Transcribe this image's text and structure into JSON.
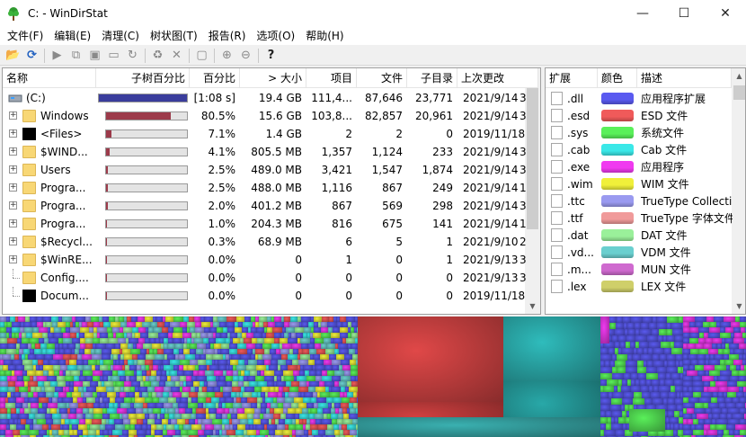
{
  "window": {
    "title": "C: - WinDirStat",
    "minimize": "—",
    "maximize": "☐",
    "close": "✕"
  },
  "menu": [
    "文件(F)",
    "编辑(E)",
    "清理(C)",
    "树状图(T)",
    "报告(R)",
    "选项(O)",
    "帮助(H)"
  ],
  "toolbar": [
    {
      "name": "open-icon",
      "glyph": "📂",
      "on": true
    },
    {
      "name": "refresh-icon",
      "glyph": "⟳",
      "on": true
    },
    {
      "name": "sep"
    },
    {
      "name": "play-icon",
      "glyph": "▶",
      "on": false
    },
    {
      "name": "copy-icon",
      "glyph": "⧉",
      "on": false
    },
    {
      "name": "explorer-icon",
      "glyph": "▣",
      "on": false
    },
    {
      "name": "cmd-icon",
      "glyph": "▭",
      "on": false
    },
    {
      "name": "refresh-selected-icon",
      "glyph": "↻",
      "on": false
    },
    {
      "name": "sep"
    },
    {
      "name": "recycle-icon",
      "glyph": "♻",
      "on": false
    },
    {
      "name": "delete-icon",
      "glyph": "✕",
      "on": false
    },
    {
      "name": "sep"
    },
    {
      "name": "properties-icon",
      "glyph": "▢",
      "on": false
    },
    {
      "name": "sep"
    },
    {
      "name": "zoom-in-icon",
      "glyph": "⊕",
      "on": false
    },
    {
      "name": "zoom-out-icon",
      "glyph": "⊖",
      "on": false
    },
    {
      "name": "sep"
    },
    {
      "name": "help-icon",
      "glyph": "?",
      "on": true
    }
  ],
  "tree": {
    "columns": [
      "名称",
      "子树百分比",
      "百分比",
      "> 大小",
      "项目",
      "文件",
      "子目录",
      "上次更改"
    ],
    "rows": [
      {
        "name": "(C:)",
        "icon": "drive",
        "expander": "",
        "indent": 0,
        "bar": 1.0,
        "bar_color": "#3a3d9c",
        "percent": "[1:08 s]",
        "size": "19.4 GB",
        "items": "111,4...",
        "files": "87,646",
        "subdirs": "23,771",
        "changed": "2021/9/14",
        "extra": "3"
      },
      {
        "name": "Windows",
        "icon": "folder",
        "expander": "+",
        "indent": 1,
        "bar": 0.805,
        "bar_color": "#9c3a4a",
        "percent": "80.5%",
        "size": "15.6 GB",
        "items": "103,8...",
        "files": "82,857",
        "subdirs": "20,961",
        "changed": "2021/9/14",
        "extra": "3"
      },
      {
        "name": "<Files>",
        "icon": "black",
        "expander": "+",
        "indent": 1,
        "bar": 0.071,
        "bar_color": "#9c3a4a",
        "percent": "7.1%",
        "size": "1.4 GB",
        "items": "2",
        "files": "2",
        "subdirs": "0",
        "changed": "2019/11/18",
        "extra": ""
      },
      {
        "name": "$WIND...",
        "icon": "folder",
        "expander": "+",
        "indent": 1,
        "bar": 0.041,
        "bar_color": "#9c3a4a",
        "percent": "4.1%",
        "size": "805.5 MB",
        "items": "1,357",
        "files": "1,124",
        "subdirs": "233",
        "changed": "2021/9/14",
        "extra": "3"
      },
      {
        "name": "Users",
        "icon": "folder",
        "expander": "+",
        "indent": 1,
        "bar": 0.025,
        "bar_color": "#9c3a4a",
        "percent": "2.5%",
        "size": "489.0 MB",
        "items": "3,421",
        "files": "1,547",
        "subdirs": "1,874",
        "changed": "2021/9/14",
        "extra": "3"
      },
      {
        "name": "Progra...",
        "icon": "folder",
        "expander": "+",
        "indent": 1,
        "bar": 0.025,
        "bar_color": "#9c3a4a",
        "percent": "2.5%",
        "size": "488.0 MB",
        "items": "1,116",
        "files": "867",
        "subdirs": "249",
        "changed": "2021/9/14",
        "extra": "1"
      },
      {
        "name": "Progra...",
        "icon": "folder",
        "expander": "+",
        "indent": 1,
        "bar": 0.02,
        "bar_color": "#9c3a4a",
        "percent": "2.0%",
        "size": "401.2 MB",
        "items": "867",
        "files": "569",
        "subdirs": "298",
        "changed": "2021/9/14",
        "extra": "3"
      },
      {
        "name": "Progra...",
        "icon": "folder",
        "expander": "+",
        "indent": 1,
        "bar": 0.01,
        "bar_color": "#9c3a4a",
        "percent": "1.0%",
        "size": "204.3 MB",
        "items": "816",
        "files": "675",
        "subdirs": "141",
        "changed": "2021/9/14",
        "extra": "1"
      },
      {
        "name": "$Recycl...",
        "icon": "folder",
        "expander": "+",
        "indent": 1,
        "bar": 0.003,
        "bar_color": "#9c3a4a",
        "percent": "0.3%",
        "size": "68.9 MB",
        "items": "6",
        "files": "5",
        "subdirs": "1",
        "changed": "2021/9/10",
        "extra": "2"
      },
      {
        "name": "$WinRE...",
        "icon": "folder",
        "expander": "+",
        "indent": 1,
        "bar": 0.0,
        "bar_color": "#9c3a4a",
        "percent": "0.0%",
        "size": "0",
        "items": "1",
        "files": "0",
        "subdirs": "1",
        "changed": "2021/9/13",
        "extra": "3"
      },
      {
        "name": "Config....",
        "icon": "folder",
        "expander": "",
        "indent": 1,
        "bar": 0.0,
        "bar_color": "#9c3a4a",
        "percent": "0.0%",
        "size": "0",
        "items": "0",
        "files": "0",
        "subdirs": "0",
        "changed": "2021/9/13",
        "extra": "3"
      },
      {
        "name": "Docum...",
        "icon": "black",
        "expander": "",
        "indent": 1,
        "bar": 0.0,
        "bar_color": "#9c3a4a",
        "percent": "0.0%",
        "size": "0",
        "items": "0",
        "files": "0",
        "subdirs": "0",
        "changed": "2019/11/18",
        "extra": ""
      }
    ]
  },
  "extensions": {
    "columns": [
      "扩展",
      "颜色",
      "描述"
    ],
    "rows": [
      {
        "ext": ".dll",
        "color": "#5a5af0",
        "desc": "应用程序扩展"
      },
      {
        "ext": ".esd",
        "color": "#f05a5a",
        "desc": "ESD 文件"
      },
      {
        "ext": ".sys",
        "color": "#5af05a",
        "desc": "系统文件"
      },
      {
        "ext": ".cab",
        "color": "#3ae8e8",
        "desc": "Cab 文件"
      },
      {
        "ext": ".exe",
        "color": "#f03af0",
        "desc": "应用程序"
      },
      {
        "ext": ".wim",
        "color": "#f0f03a",
        "desc": "WIM 文件"
      },
      {
        "ext": ".ttc",
        "color": "#9a9af0",
        "desc": "TrueType Collecti"
      },
      {
        "ext": ".ttf",
        "color": "#f09a9a",
        "desc": "TrueType 字体文件"
      },
      {
        "ext": ".dat",
        "color": "#9af09a",
        "desc": "DAT 文件"
      },
      {
        "ext": ".vd...",
        "color": "#6acfcf",
        "desc": "VDM 文件"
      },
      {
        "ext": ".m...",
        "color": "#cf6acf",
        "desc": "MUN 文件"
      },
      {
        "ext": ".lex",
        "color": "#cfcf6a",
        "desc": "LEX 文件"
      }
    ]
  }
}
